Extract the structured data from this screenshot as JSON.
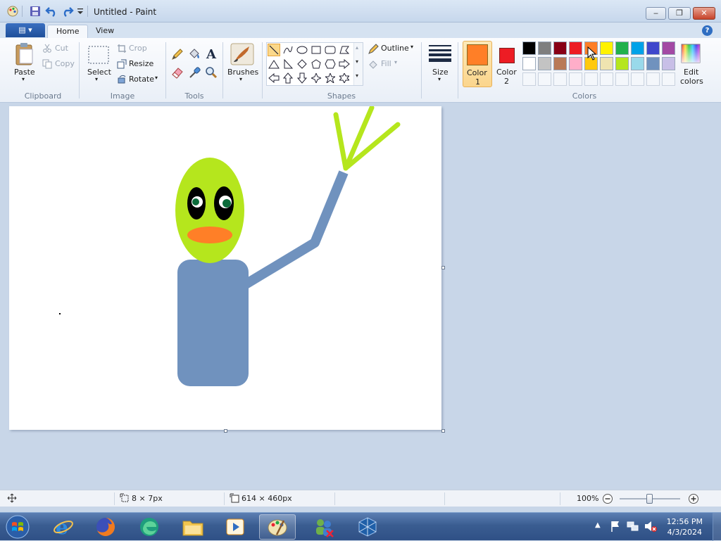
{
  "window": {
    "title": "Untitled - Paint",
    "minimize_glyph": "‒",
    "maximize_glyph": "❐",
    "close_glyph": "✕"
  },
  "tabs": {
    "file_glyph": "▤ ▾",
    "home": "Home",
    "view": "View",
    "help": "?"
  },
  "ribbon": {
    "clipboard": {
      "paste": "Paste",
      "cut": "Cut",
      "copy": "Copy",
      "group": "Clipboard"
    },
    "image": {
      "select": "Select",
      "crop": "Crop",
      "resize": "Resize",
      "rotate": "Rotate",
      "group": "Image"
    },
    "tools": {
      "group": "Tools"
    },
    "brushes": {
      "label": "Brushes"
    },
    "shapes": {
      "outline": "Outline",
      "fill": "Fill",
      "group": "Shapes"
    },
    "size": {
      "label": "Size"
    },
    "colors": {
      "color1_a": "Color",
      "color1_b": "1",
      "color2_a": "Color",
      "color2_b": "2",
      "edit_a": "Edit",
      "edit_b": "colors",
      "group": "Colors",
      "color1_value": "#ff7f27",
      "color2_value": "#ed1c24",
      "palette_row1": [
        "#000000",
        "#7f7f7f",
        "#880015",
        "#ed1c24",
        "#ff7f27",
        "#fff200",
        "#22b14c",
        "#00a2e8",
        "#3f48cc",
        "#a349a4"
      ],
      "palette_row2": [
        "#ffffff",
        "#c3c3c3",
        "#b97a57",
        "#ffaec9",
        "#ffc90e",
        "#efe4b0",
        "#b5e61d",
        "#99d9ea",
        "#7092be",
        "#c8bfe7"
      ]
    }
  },
  "drawing": {
    "head_color": "#b5e61d",
    "body_color": "#7092be",
    "mouth_color": "#ff7f27"
  },
  "status": {
    "selection_size": "8 × 7px",
    "canvas_size": "614 × 460px",
    "zoom": "100%"
  },
  "taskbar": {
    "time": "12:56 PM",
    "date": "4/3/2024"
  }
}
